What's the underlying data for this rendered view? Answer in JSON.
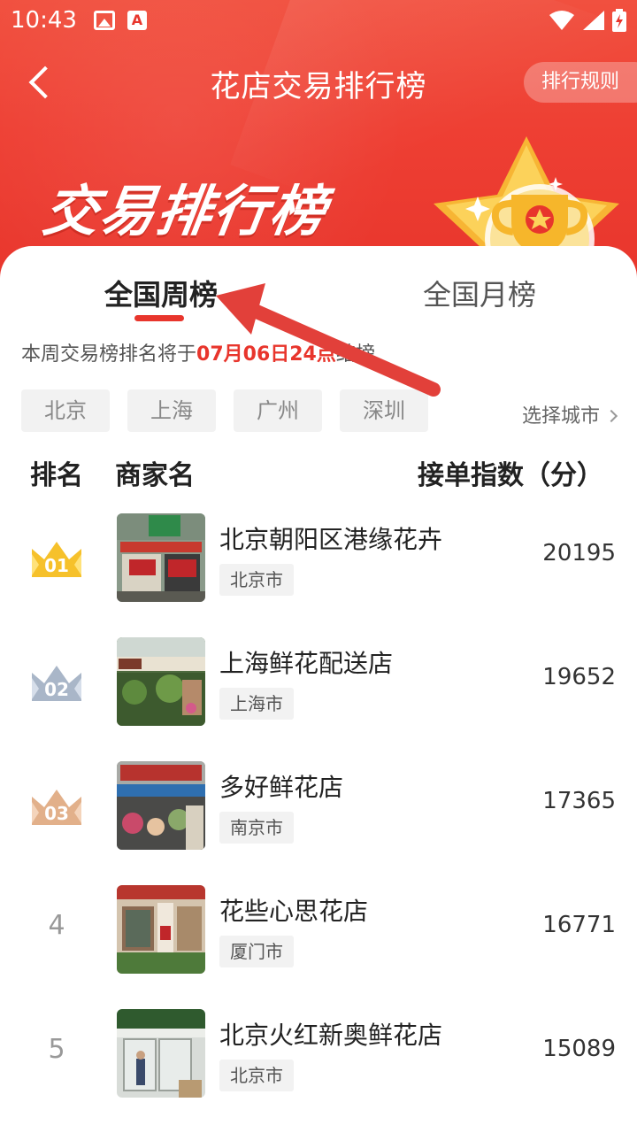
{
  "status_bar": {
    "time": "10:43"
  },
  "header": {
    "title": "花店交易排行榜",
    "rules_label": "排行规则"
  },
  "banner": {
    "title": "交易排行榜"
  },
  "tabs": [
    {
      "label": "全国周榜",
      "active": true
    },
    {
      "label": "全国月榜",
      "active": false
    }
  ],
  "notice": {
    "prefix": "本周交易榜排名将于",
    "highlight": "07月06日24点",
    "suffix": "结榜"
  },
  "cities": [
    "北京",
    "上海",
    "广州",
    "深圳"
  ],
  "city_select_label": "选择城市",
  "columns": {
    "rank": "排名",
    "name": "商家名",
    "score": "接单指数（分）"
  },
  "rows": [
    {
      "rank": "01",
      "name": "北京朝阳区港缘花卉",
      "city": "北京市",
      "score": "20195",
      "medal": "gold"
    },
    {
      "rank": "02",
      "name": "上海鲜花配送店",
      "city": "上海市",
      "score": "19652",
      "medal": "silver"
    },
    {
      "rank": "03",
      "name": "多好鲜花店",
      "city": "南京市",
      "score": "17365",
      "medal": "bronze"
    },
    {
      "rank": "4",
      "name": "花些心思花店",
      "city": "厦门市",
      "score": "16771",
      "medal": ""
    },
    {
      "rank": "5",
      "name": "北京火红新奥鲜花店",
      "city": "北京市",
      "score": "15089",
      "medal": ""
    }
  ],
  "colors": {
    "brand_red": "#e8352c",
    "gold": "#f6c12b",
    "silver": "#a9b6c8",
    "bronze": "#e2b08a"
  }
}
